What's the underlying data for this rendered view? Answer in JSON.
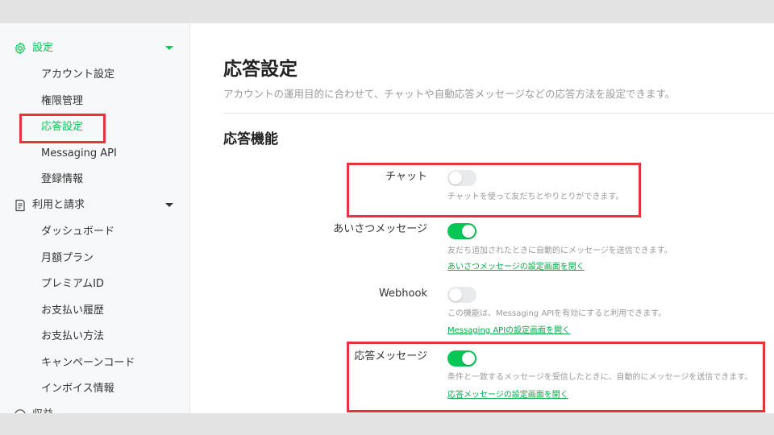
{
  "sidebar": {
    "settings_group": {
      "label": "設定",
      "icon": "gear-icon"
    },
    "settings_items": [
      {
        "label": "アカウント設定"
      },
      {
        "label": "権限管理"
      },
      {
        "label": "応答設定"
      },
      {
        "label": "Messaging API"
      },
      {
        "label": "登録情報"
      }
    ],
    "billing_group": {
      "label": "利用と請求",
      "icon": "receipt-icon"
    },
    "billing_items": [
      {
        "label": "ダッシュボード"
      },
      {
        "label": "月額プラン"
      },
      {
        "label": "プレミアムID"
      },
      {
        "label": "お支払い履歴"
      },
      {
        "label": "お支払い方法"
      },
      {
        "label": "キャンペーンコード"
      },
      {
        "label": "インボイス情報"
      }
    ],
    "next_group": {
      "label": "収益"
    }
  },
  "main": {
    "title": "応答設定",
    "description": "アカウントの運用目的に合わせて、チャットや自動応答メッセージなどの応答方法を設定できます。",
    "section_title": "応答機能",
    "settings": [
      {
        "label": "チャット",
        "enabled": false,
        "description": "チャットを使って友だちとやりとりができます。",
        "link": ""
      },
      {
        "label": "あいさつメッセージ",
        "enabled": true,
        "description": "友だち追加されたときに自動的にメッセージを送信できます。",
        "link": "あいさつメッセージの設定画面を開く"
      },
      {
        "label": "Webhook",
        "enabled": false,
        "description": "この機能は、Messaging APIを有効にすると利用できます。",
        "link": "Messaging APIの設定画面を開く"
      },
      {
        "label": "応答メッセージ",
        "enabled": true,
        "description": "条件と一致するメッセージを受信したときに、自動的にメッセージを送信できます。",
        "link": "応答メッセージの設定画面を開く"
      }
    ]
  },
  "colors": {
    "accent": "#06c755",
    "highlight": "#e8323c"
  }
}
